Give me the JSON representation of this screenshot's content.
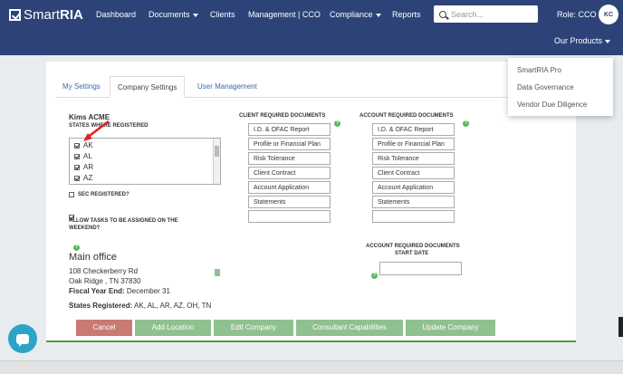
{
  "navbar": {
    "logo_prefix": "Smart",
    "logo_suffix": "RIA",
    "items": [
      "Dashboard",
      "Documents",
      "Clients",
      "Management | CCO",
      "Compliance",
      "Reports"
    ],
    "search_placeholder": "Search...",
    "role": "Role: CCO",
    "avatar": "KC",
    "our_products": "Our Products"
  },
  "products_menu": [
    "SmartRIA Pro",
    "Data Governance",
    "Vendor Due Diligence"
  ],
  "tabs": [
    "My Settings",
    "Company Settings",
    "User Management"
  ],
  "company": {
    "name": "Kims ACME",
    "states_label": "STATES WHERE REGISTERED",
    "states": [
      "AK",
      "AL",
      "AR",
      "AZ"
    ],
    "sec_label": "SEC REGISTERED?",
    "weekend_label_1": "ALLOW TASKS TO BE ASSIGNED ON THE",
    "weekend_label_2": "WEEKEND?"
  },
  "client_docs": {
    "title": "CLIENT REQUIRED DOCUMENTS",
    "items": [
      "I.D. & OFAC Report",
      "Profile or Financial Plan",
      "Risk Tolerance",
      "Client Contract",
      "Account Application",
      "Statements",
      ""
    ]
  },
  "account_docs": {
    "title": "ACCOUNT REQUIRED DOCUMENTS",
    "items": [
      "I.D. & OFAC Report",
      "Profile or Financial Plan",
      "Risk Tolerance",
      "Client Contract",
      "Account Application",
      "Statements",
      ""
    ],
    "start_date_1": "ACCOUNT REQUIRED DOCUMENTS",
    "start_date_2": "START DATE"
  },
  "office": {
    "title": "Main office",
    "address1": "108 Checkerberry Rd",
    "address2": "Oak Ridge , TN 37830",
    "fy_label": "Fiscal Year End:",
    "fy_value": "December 31",
    "states_label": "States Registered:",
    "states_value": "AK, AL, AR, AZ, OH, TN"
  },
  "buttons": [
    "Cancel",
    "Add Location",
    "Edit Company",
    "Consultant Capabilities",
    "Update Company"
  ],
  "colors": {
    "navbar": "#2d4378",
    "green": "#8fc08f",
    "cancel": "#c97a72",
    "chat": "#2aa5c5"
  }
}
